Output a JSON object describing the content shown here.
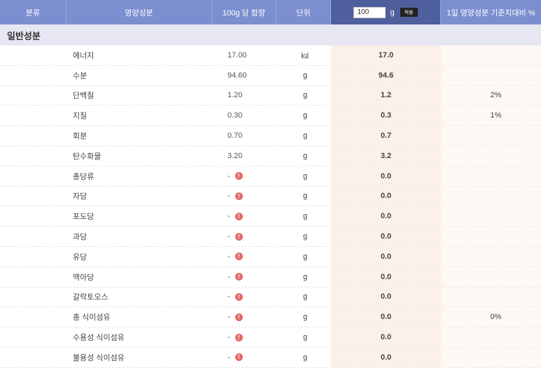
{
  "header": {
    "category": "분류",
    "nutrient": "영양성분",
    "per100g": "100g 당 함량",
    "unit": "단위",
    "amount_value": "100",
    "amount_unit": "g",
    "apply_button": "적용",
    "daily_pct": "1일 영양성분 기준치대비 %"
  },
  "section_title": "일반성분",
  "warn_symbol": "!",
  "rows": [
    {
      "name": "에너지",
      "amount": "17.00",
      "unit": "㎉",
      "calc": "17.0",
      "daily": ""
    },
    {
      "name": "수분",
      "amount": "94.60",
      "unit": "g",
      "calc": "94.6",
      "daily": ""
    },
    {
      "name": "단백질",
      "amount": "1.20",
      "unit": "g",
      "calc": "1.2",
      "daily": "2%"
    },
    {
      "name": "지질",
      "amount": "0.30",
      "unit": "g",
      "calc": "0.3",
      "daily": "1%"
    },
    {
      "name": "회분",
      "amount": "0.70",
      "unit": "g",
      "calc": "0.7",
      "daily": ""
    },
    {
      "name": "탄수화물",
      "amount": "3.20",
      "unit": "g",
      "calc": "3.2",
      "daily": ""
    },
    {
      "name": "총당류",
      "amount": "-",
      "unit": "g",
      "calc": "0.0",
      "daily": ""
    },
    {
      "name": "자당",
      "amount": "-",
      "unit": "g",
      "calc": "0.0",
      "daily": ""
    },
    {
      "name": "포도당",
      "amount": "-",
      "unit": "g",
      "calc": "0.0",
      "daily": ""
    },
    {
      "name": "과당",
      "amount": "-",
      "unit": "g",
      "calc": "0.0",
      "daily": ""
    },
    {
      "name": "유당",
      "amount": "-",
      "unit": "g",
      "calc": "0.0",
      "daily": ""
    },
    {
      "name": "맥아당",
      "amount": "-",
      "unit": "g",
      "calc": "0.0",
      "daily": ""
    },
    {
      "name": "갈락토오스",
      "amount": "-",
      "unit": "g",
      "calc": "0.0",
      "daily": ""
    },
    {
      "name": "총 식이섬유",
      "amount": "-",
      "unit": "g",
      "calc": "0.0",
      "daily": "0%"
    },
    {
      "name": "수용성 식이섬유",
      "amount": "-",
      "unit": "g",
      "calc": "0.0",
      "daily": ""
    },
    {
      "name": "불용성 식이섬유",
      "amount": "-",
      "unit": "g",
      "calc": "0.0",
      "daily": ""
    }
  ]
}
